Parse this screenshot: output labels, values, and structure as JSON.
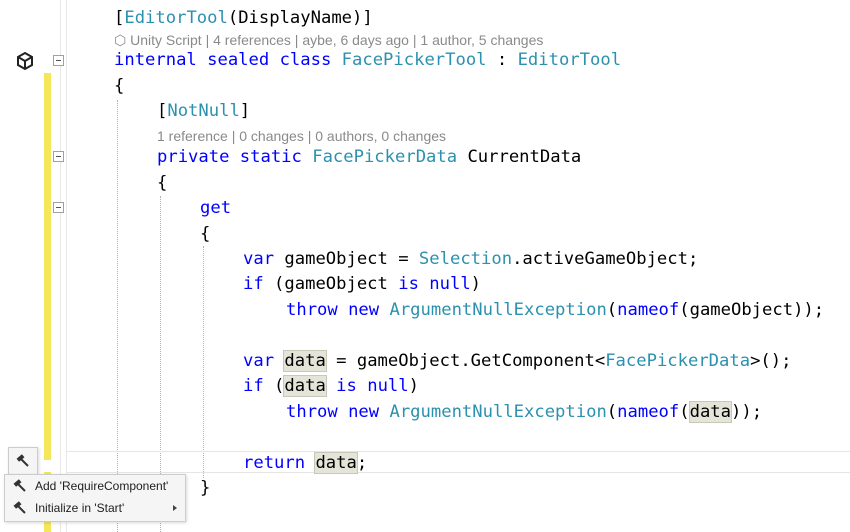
{
  "codelens": {
    "class_lens": "⬡ Unity Script | 4 references | aybe, 6 days ago | 1 author, 5 changes",
    "prop_lens": "1 reference | 0 changes | 0 authors, 0 changes"
  },
  "code": {
    "l1_attr": "EditorTool",
    "l1_arg": "(DisplayName)]",
    "l2_kw": "internal sealed class ",
    "l2_name": "FacePickerTool",
    "l2_sep": " : ",
    "l2_base": "EditorTool",
    "brace_open": "{",
    "brace_close": "}",
    "l3_attr": "NotNull",
    "l4_kw": "private static ",
    "l4_type": "FacePickerData",
    "l4_name": " CurrentData",
    "l5_get": "get",
    "l6_var": "var",
    "l6_rest1": " gameObject = ",
    "l6_type": "Selection",
    "l6_rest2": ".activeGameObject;",
    "l7_if": "if",
    "l7_rest1": " (gameObject ",
    "l7_is": "is null",
    "l7_rest2": ")",
    "l8_throw": "throw new ",
    "l8_type": "ArgumentNullException",
    "l8_p": "(",
    "l8_nameof": "nameof",
    "l8_rest": "(gameObject));",
    "l9_var": "var",
    "l9_space": " ",
    "l9_data": "data",
    "l9_rest1": " = gameObject.GetComponent<",
    "l9_type": "FacePickerData",
    "l9_rest2": ">();",
    "l10_if": "if",
    "l10_p": " (",
    "l10_data": "data",
    "l10_sp": " ",
    "l10_is": "is null",
    "l10_rest": ")",
    "l11_throw": "throw new ",
    "l11_type": "ArgumentNullException",
    "l11_p": "(",
    "l11_nameof": "nameof",
    "l11_p2": "(",
    "l11_data": "data",
    "l11_rest": "));",
    "l12_return": "return",
    "l12_sp": " ",
    "l12_data": "data",
    "l12_semi": ";"
  },
  "quick_actions": {
    "items": [
      {
        "label": "Add 'RequireComponent'",
        "icon": "hammer-icon"
      },
      {
        "label": "Initialize in 'Start'",
        "icon": "hammer-icon",
        "has_submenu": true
      }
    ]
  },
  "colors": {
    "keyword": "#0000ff",
    "type": "#2b91af",
    "change_bar": "#f5e65a",
    "highlight": "#e4e4d8"
  }
}
